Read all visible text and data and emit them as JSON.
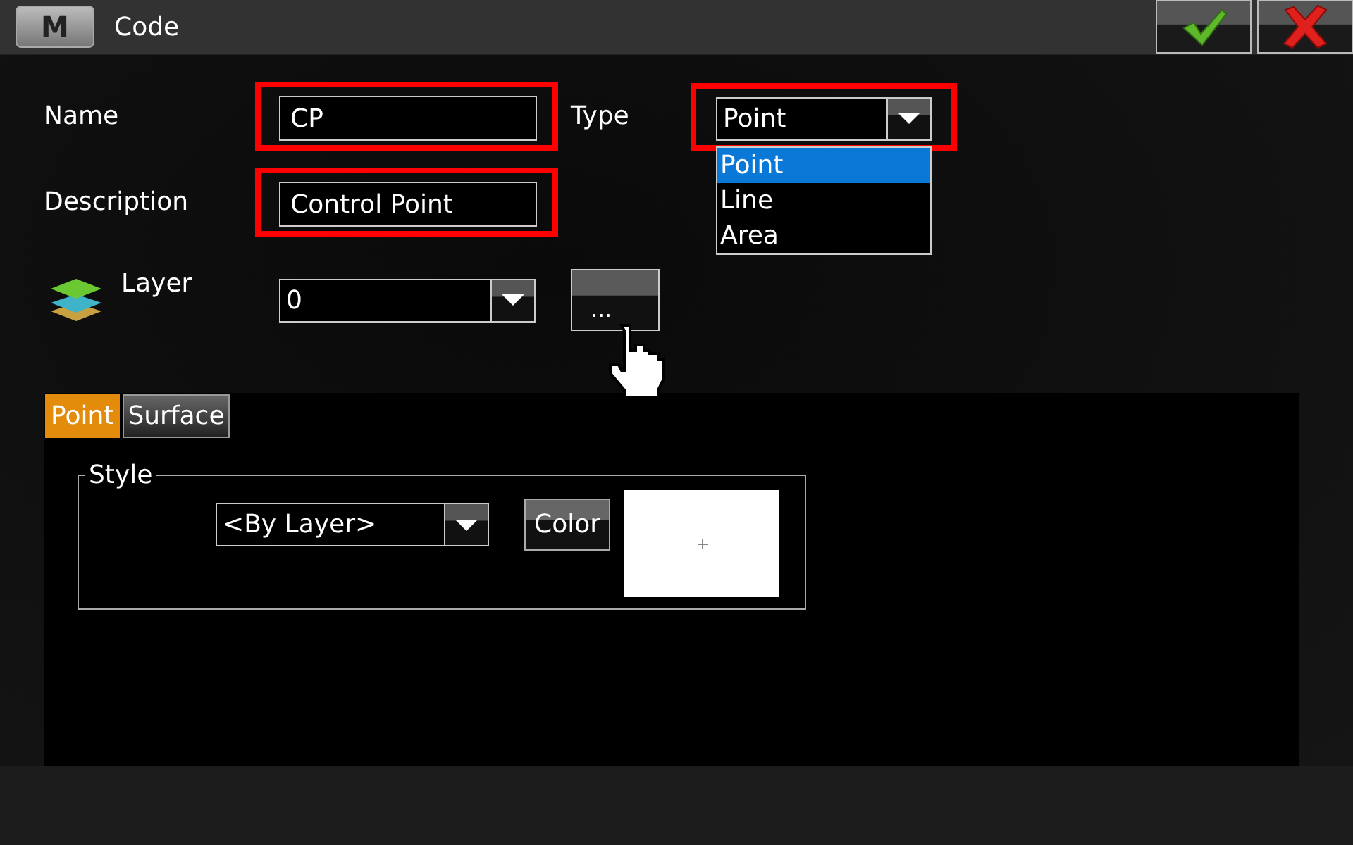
{
  "window": {
    "logo": "M",
    "title": "Code"
  },
  "form": {
    "name": {
      "label": "Name",
      "value": "CP",
      "highlighted": true
    },
    "type": {
      "label": "Type",
      "value": "Point",
      "highlighted": true,
      "expanded": true,
      "options": [
        {
          "label": "Point",
          "selected": true
        },
        {
          "label": "Line",
          "selected": false
        },
        {
          "label": "Area",
          "selected": false
        }
      ]
    },
    "description": {
      "label": "Description",
      "value": "Control Point",
      "highlighted": true
    },
    "layer": {
      "label": "Layer",
      "value": "0",
      "browse_button": "..."
    }
  },
  "tabs": [
    {
      "label": "Point",
      "selected": true
    },
    {
      "label": "Surface",
      "selected": false
    }
  ],
  "style": {
    "legend": "Style",
    "linetype": "<By Layer>",
    "color_button": "Color"
  }
}
